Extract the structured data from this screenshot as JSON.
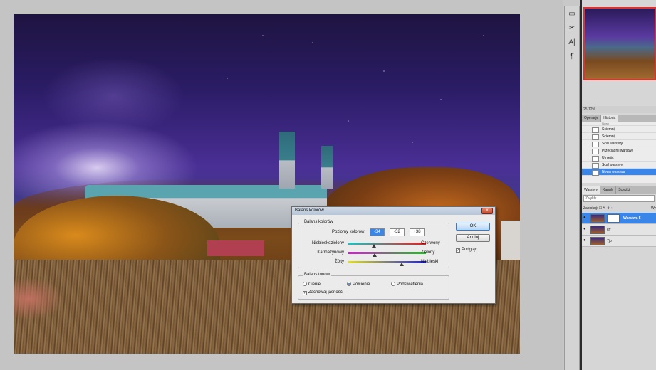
{
  "dialog": {
    "title": "Balans kolorów",
    "group_color_balance": "Balans kolorów",
    "color_levels_label": "Poziomy kolorów:",
    "levels": [
      "-34",
      "-32",
      "+38"
    ],
    "sliders": [
      {
        "left": "Niebieskozielony",
        "right": "Czerwony",
        "value": -34,
        "color_left": "#20c0c0",
        "color_right": "#e02020"
      },
      {
        "left": "Karmazynowy",
        "right": "Zielony",
        "value": -32,
        "color_left": "#d020d0",
        "color_right": "#20c020"
      },
      {
        "left": "Żółty",
        "right": "Niebieski",
        "value": 38,
        "color_left": "#e0e020",
        "color_right": "#2020d0"
      }
    ],
    "group_tone_balance": "Balans tonów",
    "tones": [
      {
        "label": "Cienie",
        "selected": false
      },
      {
        "label": "Półcienie",
        "selected": true
      },
      {
        "label": "Podświetlenia",
        "selected": false
      }
    ],
    "preserve_luminosity": "Zachowaj jasność",
    "preserve_checked": true,
    "ok_label": "OK",
    "cancel_label": "Anuluj",
    "preview_label": "Podgląd",
    "preview_checked": true,
    "close_symbol": "x"
  },
  "toolstrip": [
    "▭",
    "✂",
    "A|",
    "¶"
  ],
  "navigator": {
    "zoom": "25,12%"
  },
  "history": {
    "tabs": [
      {
        "label": "Operacje",
        "active": false
      },
      {
        "label": "Historia",
        "active": true
      }
    ],
    "snapshot_row": "Nowy",
    "items": [
      {
        "label": "Ściemnij",
        "selected": false
      },
      {
        "label": "Ściemnij",
        "selected": false
      },
      {
        "label": "Scal warstwy",
        "selected": false
      },
      {
        "label": "Przeciągnij warstwę",
        "selected": false
      },
      {
        "label": "Umieść",
        "selected": false
      },
      {
        "label": "Scal warstwy",
        "selected": false
      },
      {
        "label": "Nowa warstwa",
        "selected": true
      }
    ]
  },
  "layers": {
    "tabs": [
      {
        "label": "Warstwy",
        "active": true
      },
      {
        "label": "Kanały",
        "active": false
      },
      {
        "label": "Ścieżki",
        "active": false
      }
    ],
    "blend_mode": "Zwykły",
    "lock_label": "Zablokuj:",
    "opacity_label": "Wy",
    "items": [
      {
        "name": "Warstwa 5",
        "selected": true,
        "has_mask": true
      },
      {
        "name": "crf",
        "selected": false,
        "has_mask": false
      },
      {
        "name": "7jb",
        "selected": false,
        "has_mask": false
      }
    ]
  }
}
